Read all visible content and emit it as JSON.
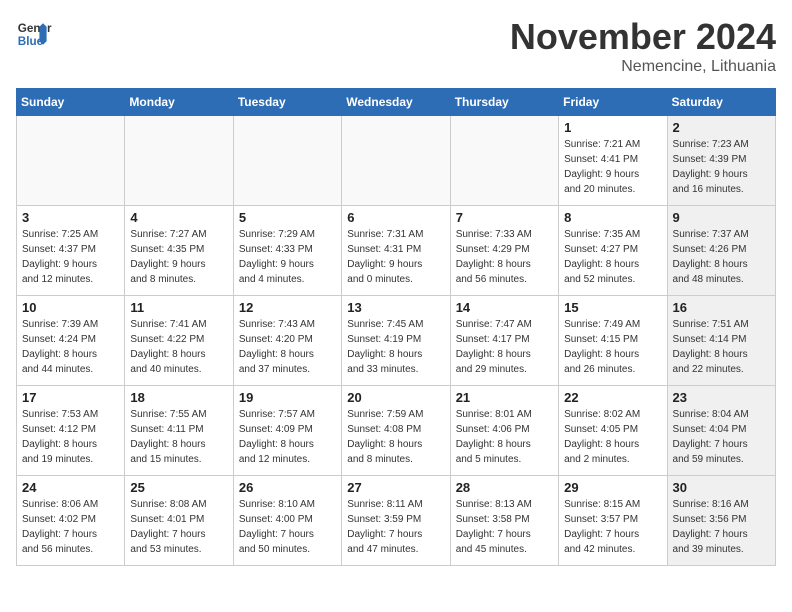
{
  "header": {
    "logo_line1": "General",
    "logo_line2": "Blue",
    "month": "November 2024",
    "location": "Nemencine, Lithuania"
  },
  "weekdays": [
    "Sunday",
    "Monday",
    "Tuesday",
    "Wednesday",
    "Thursday",
    "Friday",
    "Saturday"
  ],
  "weeks": [
    [
      {
        "day": "",
        "info": "",
        "shaded": true
      },
      {
        "day": "",
        "info": "",
        "shaded": true
      },
      {
        "day": "",
        "info": "",
        "shaded": true
      },
      {
        "day": "",
        "info": "",
        "shaded": true
      },
      {
        "day": "",
        "info": "",
        "shaded": true
      },
      {
        "day": "1",
        "info": "Sunrise: 7:21 AM\nSunset: 4:41 PM\nDaylight: 9 hours\nand 20 minutes.",
        "shaded": false
      },
      {
        "day": "2",
        "info": "Sunrise: 7:23 AM\nSunset: 4:39 PM\nDaylight: 9 hours\nand 16 minutes.",
        "shaded": true
      }
    ],
    [
      {
        "day": "3",
        "info": "Sunrise: 7:25 AM\nSunset: 4:37 PM\nDaylight: 9 hours\nand 12 minutes.",
        "shaded": false
      },
      {
        "day": "4",
        "info": "Sunrise: 7:27 AM\nSunset: 4:35 PM\nDaylight: 9 hours\nand 8 minutes.",
        "shaded": false
      },
      {
        "day": "5",
        "info": "Sunrise: 7:29 AM\nSunset: 4:33 PM\nDaylight: 9 hours\nand 4 minutes.",
        "shaded": false
      },
      {
        "day": "6",
        "info": "Sunrise: 7:31 AM\nSunset: 4:31 PM\nDaylight: 9 hours\nand 0 minutes.",
        "shaded": false
      },
      {
        "day": "7",
        "info": "Sunrise: 7:33 AM\nSunset: 4:29 PM\nDaylight: 8 hours\nand 56 minutes.",
        "shaded": false
      },
      {
        "day": "8",
        "info": "Sunrise: 7:35 AM\nSunset: 4:27 PM\nDaylight: 8 hours\nand 52 minutes.",
        "shaded": false
      },
      {
        "day": "9",
        "info": "Sunrise: 7:37 AM\nSunset: 4:26 PM\nDaylight: 8 hours\nand 48 minutes.",
        "shaded": true
      }
    ],
    [
      {
        "day": "10",
        "info": "Sunrise: 7:39 AM\nSunset: 4:24 PM\nDaylight: 8 hours\nand 44 minutes.",
        "shaded": false
      },
      {
        "day": "11",
        "info": "Sunrise: 7:41 AM\nSunset: 4:22 PM\nDaylight: 8 hours\nand 40 minutes.",
        "shaded": false
      },
      {
        "day": "12",
        "info": "Sunrise: 7:43 AM\nSunset: 4:20 PM\nDaylight: 8 hours\nand 37 minutes.",
        "shaded": false
      },
      {
        "day": "13",
        "info": "Sunrise: 7:45 AM\nSunset: 4:19 PM\nDaylight: 8 hours\nand 33 minutes.",
        "shaded": false
      },
      {
        "day": "14",
        "info": "Sunrise: 7:47 AM\nSunset: 4:17 PM\nDaylight: 8 hours\nand 29 minutes.",
        "shaded": false
      },
      {
        "day": "15",
        "info": "Sunrise: 7:49 AM\nSunset: 4:15 PM\nDaylight: 8 hours\nand 26 minutes.",
        "shaded": false
      },
      {
        "day": "16",
        "info": "Sunrise: 7:51 AM\nSunset: 4:14 PM\nDaylight: 8 hours\nand 22 minutes.",
        "shaded": true
      }
    ],
    [
      {
        "day": "17",
        "info": "Sunrise: 7:53 AM\nSunset: 4:12 PM\nDaylight: 8 hours\nand 19 minutes.",
        "shaded": false
      },
      {
        "day": "18",
        "info": "Sunrise: 7:55 AM\nSunset: 4:11 PM\nDaylight: 8 hours\nand 15 minutes.",
        "shaded": false
      },
      {
        "day": "19",
        "info": "Sunrise: 7:57 AM\nSunset: 4:09 PM\nDaylight: 8 hours\nand 12 minutes.",
        "shaded": false
      },
      {
        "day": "20",
        "info": "Sunrise: 7:59 AM\nSunset: 4:08 PM\nDaylight: 8 hours\nand 8 minutes.",
        "shaded": false
      },
      {
        "day": "21",
        "info": "Sunrise: 8:01 AM\nSunset: 4:06 PM\nDaylight: 8 hours\nand 5 minutes.",
        "shaded": false
      },
      {
        "day": "22",
        "info": "Sunrise: 8:02 AM\nSunset: 4:05 PM\nDaylight: 8 hours\nand 2 minutes.",
        "shaded": false
      },
      {
        "day": "23",
        "info": "Sunrise: 8:04 AM\nSunset: 4:04 PM\nDaylight: 7 hours\nand 59 minutes.",
        "shaded": true
      }
    ],
    [
      {
        "day": "24",
        "info": "Sunrise: 8:06 AM\nSunset: 4:02 PM\nDaylight: 7 hours\nand 56 minutes.",
        "shaded": false
      },
      {
        "day": "25",
        "info": "Sunrise: 8:08 AM\nSunset: 4:01 PM\nDaylight: 7 hours\nand 53 minutes.",
        "shaded": false
      },
      {
        "day": "26",
        "info": "Sunrise: 8:10 AM\nSunset: 4:00 PM\nDaylight: 7 hours\nand 50 minutes.",
        "shaded": false
      },
      {
        "day": "27",
        "info": "Sunrise: 8:11 AM\nSunset: 3:59 PM\nDaylight: 7 hours\nand 47 minutes.",
        "shaded": false
      },
      {
        "day": "28",
        "info": "Sunrise: 8:13 AM\nSunset: 3:58 PM\nDaylight: 7 hours\nand 45 minutes.",
        "shaded": false
      },
      {
        "day": "29",
        "info": "Sunrise: 8:15 AM\nSunset: 3:57 PM\nDaylight: 7 hours\nand 42 minutes.",
        "shaded": false
      },
      {
        "day": "30",
        "info": "Sunrise: 8:16 AM\nSunset: 3:56 PM\nDaylight: 7 hours\nand 39 minutes.",
        "shaded": true
      }
    ]
  ]
}
